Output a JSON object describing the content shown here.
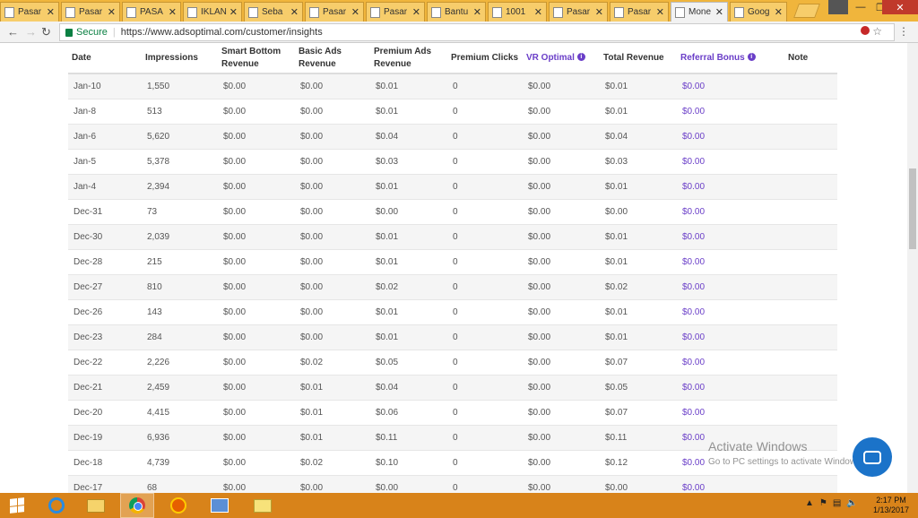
{
  "browser": {
    "tabs": [
      {
        "label": "Pasar",
        "active": false
      },
      {
        "label": "Pasar",
        "active": false
      },
      {
        "label": "PASA",
        "active": false
      },
      {
        "label": "IKLAN",
        "active": false
      },
      {
        "label": "Seba",
        "active": false
      },
      {
        "label": "Pasar",
        "active": false
      },
      {
        "label": "Pasar",
        "active": false
      },
      {
        "label": "Bantu",
        "active": false
      },
      {
        "label": "1001",
        "active": false
      },
      {
        "label": "Pasar",
        "active": false
      },
      {
        "label": "Pasar",
        "active": false
      },
      {
        "label": "Mone",
        "active": true
      },
      {
        "label": "Goog",
        "active": false
      }
    ],
    "secure_label": "Secure",
    "url": "https://www.adsoptimal.com/customer/insights"
  },
  "table": {
    "headers": [
      {
        "label": "Date",
        "info": false,
        "accent": false
      },
      {
        "label": "Impressions",
        "info": false,
        "accent": false
      },
      {
        "label": "Smart Bottom Revenue",
        "info": false,
        "accent": false
      },
      {
        "label": "Basic Ads Revenue",
        "info": false,
        "accent": false
      },
      {
        "label": "Premium Ads Revenue",
        "info": false,
        "accent": false
      },
      {
        "label": "Premium Clicks",
        "info": false,
        "accent": false
      },
      {
        "label": "VR Optimal",
        "info": true,
        "accent": true
      },
      {
        "label": "Total Revenue",
        "info": false,
        "accent": false
      },
      {
        "label": "Referral Bonus",
        "info": true,
        "accent": true
      },
      {
        "label": "Note",
        "info": false,
        "accent": false
      }
    ],
    "rows": [
      [
        "Jan-10",
        "1,550",
        "$0.00",
        "$0.00",
        "$0.01",
        "0",
        "$0.00",
        "$0.01",
        "$0.00",
        ""
      ],
      [
        "Jan-8",
        "513",
        "$0.00",
        "$0.00",
        "$0.01",
        "0",
        "$0.00",
        "$0.01",
        "$0.00",
        ""
      ],
      [
        "Jan-6",
        "5,620",
        "$0.00",
        "$0.00",
        "$0.04",
        "0",
        "$0.00",
        "$0.04",
        "$0.00",
        ""
      ],
      [
        "Jan-5",
        "5,378",
        "$0.00",
        "$0.00",
        "$0.03",
        "0",
        "$0.00",
        "$0.03",
        "$0.00",
        ""
      ],
      [
        "Jan-4",
        "2,394",
        "$0.00",
        "$0.00",
        "$0.01",
        "0",
        "$0.00",
        "$0.01",
        "$0.00",
        ""
      ],
      [
        "Dec-31",
        "73",
        "$0.00",
        "$0.00",
        "$0.00",
        "0",
        "$0.00",
        "$0.00",
        "$0.00",
        ""
      ],
      [
        "Dec-30",
        "2,039",
        "$0.00",
        "$0.00",
        "$0.01",
        "0",
        "$0.00",
        "$0.01",
        "$0.00",
        ""
      ],
      [
        "Dec-28",
        "215",
        "$0.00",
        "$0.00",
        "$0.01",
        "0",
        "$0.00",
        "$0.01",
        "$0.00",
        ""
      ],
      [
        "Dec-27",
        "810",
        "$0.00",
        "$0.00",
        "$0.02",
        "0",
        "$0.00",
        "$0.02",
        "$0.00",
        ""
      ],
      [
        "Dec-26",
        "143",
        "$0.00",
        "$0.00",
        "$0.01",
        "0",
        "$0.00",
        "$0.01",
        "$0.00",
        ""
      ],
      [
        "Dec-23",
        "284",
        "$0.00",
        "$0.00",
        "$0.01",
        "0",
        "$0.00",
        "$0.01",
        "$0.00",
        ""
      ],
      [
        "Dec-22",
        "2,226",
        "$0.00",
        "$0.02",
        "$0.05",
        "0",
        "$0.00",
        "$0.07",
        "$0.00",
        ""
      ],
      [
        "Dec-21",
        "2,459",
        "$0.00",
        "$0.01",
        "$0.04",
        "0",
        "$0.00",
        "$0.05",
        "$0.00",
        ""
      ],
      [
        "Dec-20",
        "4,415",
        "$0.00",
        "$0.01",
        "$0.06",
        "0",
        "$0.00",
        "$0.07",
        "$0.00",
        ""
      ],
      [
        "Dec-19",
        "6,936",
        "$0.00",
        "$0.01",
        "$0.11",
        "0",
        "$0.00",
        "$0.11",
        "$0.00",
        ""
      ],
      [
        "Dec-18",
        "4,739",
        "$0.00",
        "$0.02",
        "$0.10",
        "0",
        "$0.00",
        "$0.12",
        "$0.00",
        ""
      ],
      [
        "Dec-17",
        "68",
        "$0.00",
        "$0.00",
        "$0.00",
        "0",
        "$0.00",
        "$0.00",
        "$0.00",
        ""
      ]
    ]
  },
  "watermark": {
    "line1": "Activate Windows",
    "line2": "Go to PC settings to activate Windows."
  },
  "taskbar": {
    "time": "2:17 PM",
    "date": "1/13/2017"
  },
  "colors": {
    "accent": "#6a3ec8",
    "tab_strip": "#f0b53c",
    "taskbar": "#d8831a",
    "secure": "#0b8043"
  }
}
